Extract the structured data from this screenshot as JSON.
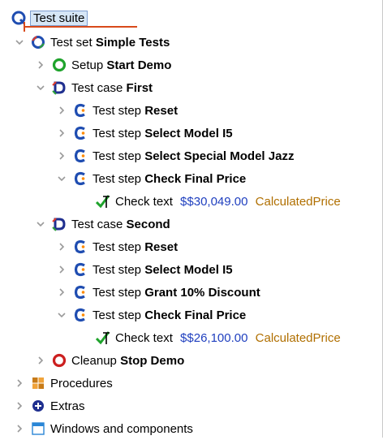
{
  "tree": {
    "root": {
      "label": "Test suite"
    },
    "test_set": {
      "prefix": "Test set",
      "name": "Simple Tests"
    },
    "setup": {
      "prefix": "Setup",
      "name": "Start Demo"
    },
    "case1": {
      "prefix": "Test case",
      "name": "First"
    },
    "case1_steps": [
      {
        "prefix": "Test step",
        "name": "Reset"
      },
      {
        "prefix": "Test step",
        "name": "Select Model I5"
      },
      {
        "prefix": "Test step",
        "name": "Select Special Model Jazz"
      },
      {
        "prefix": "Test step",
        "name": "Check Final Price"
      }
    ],
    "case1_check": {
      "prefix": "Check text",
      "value": "$$30,049.00",
      "target": "CalculatedPrice"
    },
    "case2": {
      "prefix": "Test case",
      "name": "Second"
    },
    "case2_steps": [
      {
        "prefix": "Test step",
        "name": "Reset"
      },
      {
        "prefix": "Test step",
        "name": "Select Model I5"
      },
      {
        "prefix": "Test step",
        "name": "Grant 10% Discount"
      },
      {
        "prefix": "Test step",
        "name": "Check Final Price"
      }
    ],
    "case2_check": {
      "prefix": "Check text",
      "value": "$$26,100.00",
      "target": "CalculatedPrice"
    },
    "cleanup": {
      "prefix": "Cleanup",
      "name": "Stop Demo"
    },
    "procedures": {
      "label": "Procedures"
    },
    "extras": {
      "label": "Extras"
    },
    "windows": {
      "label": "Windows and components"
    }
  }
}
